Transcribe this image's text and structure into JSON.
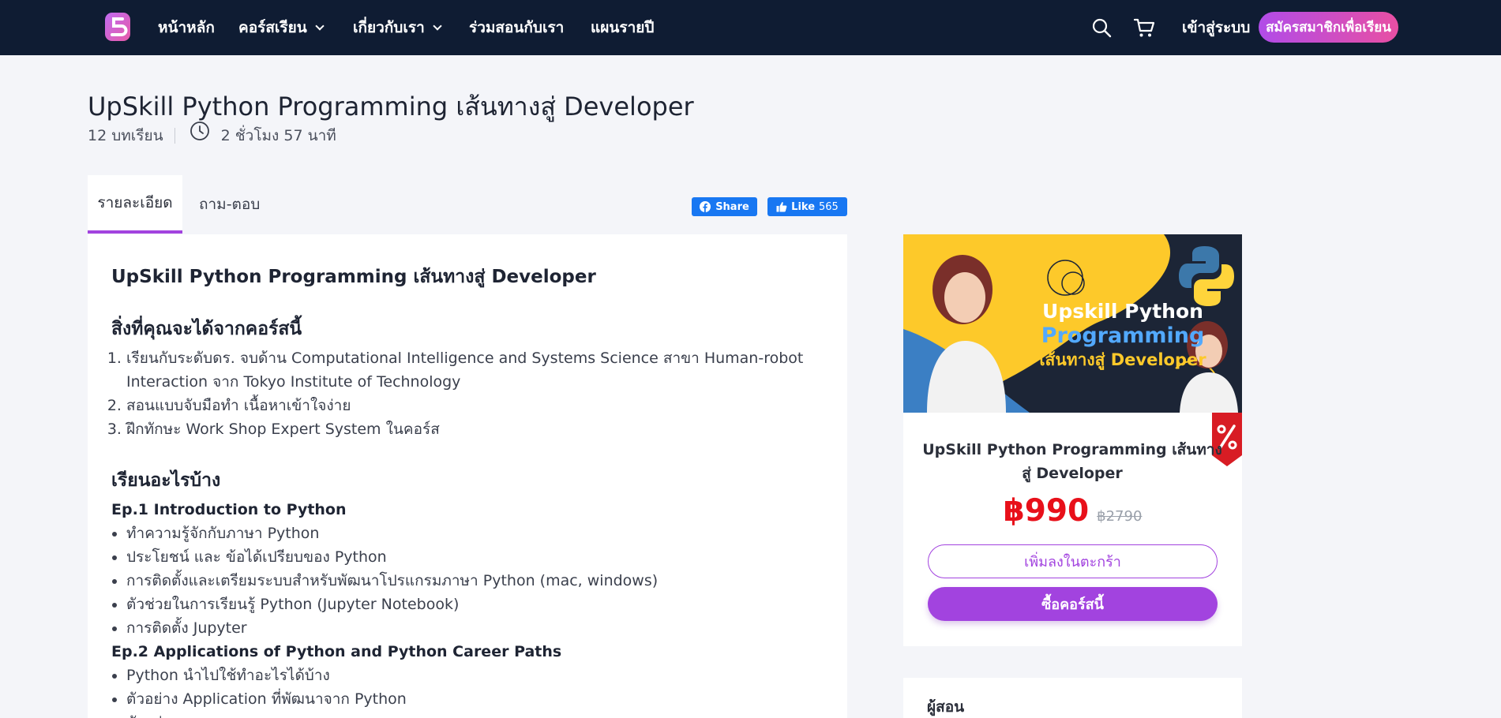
{
  "nav": {
    "home": "หน้าหลัก",
    "courses": "คอร์สเรียน",
    "about": "เกี่ยวกับเรา",
    "teach": "ร่วมสอนกับเรา",
    "plans": "แผนรายปี",
    "login": "เข้าสู่ระบบ",
    "signup": "สมัครสมาชิกเพื่อเรียน"
  },
  "course": {
    "title": "UpSkill Python Programming เส้นทางสู่ Developer",
    "lessons": "12 บทเรียน",
    "duration": "2 ชั่วโมง 57 นาที"
  },
  "tabs": {
    "details": "รายละเอียด",
    "qa": "ถาม-ตอบ"
  },
  "social": {
    "share": "Share",
    "like": "Like",
    "like_count": "565"
  },
  "content": {
    "heading": "UpSkill  Python Programming เส้นทางสู่  Developer",
    "gain_heading": "สิ่งที่คุณจะได้จากคอร์สนี้",
    "gains": [
      "เรียนกับระดับดร. จบด้าน Computational Intelligence and Systems Science สาขา Human-robot Interaction จาก Tokyo Institute of Technology",
      "สอนแบบจับมือทำ เนื้อหาเข้าใจง่าย",
      "ฝึกทักษะ Work Shop Expert System ในคอร์ส"
    ],
    "learn_heading": "เรียนอะไรบ้าง",
    "ep1_title": "Ep.1 Introduction to Python",
    "ep1_items": [
      "ทำความรู้จักกับภาษา Python",
      "ประโยชน์ และ ข้อได้เปรียบของ Python",
      "การติดตั้งและเตรียมระบบสำหรับพัฒนาโปรแกรมภาษา Python (mac, windows)",
      "ตัวช่วยในการเรียนรู้ Python (Jupyter Notebook)",
      "การติดตั้ง Jupyter"
    ],
    "ep2_title": "Ep.2 Applications of Python and Python Career Paths",
    "ep2_items": [
      "Python นำไปใช้ทำอะไรได้บ้าง",
      "ตัวอย่าง Application ที่พัฒนาจาก Python",
      "ตัวอย่าง..."
    ]
  },
  "sidebar": {
    "thumb_line1": "Upskill Python",
    "thumb_line2": "Programming",
    "thumb_line3": "เส้นทางสู่ Developer",
    "title": "UpSkill Python Programming เส้นทางสู่ Developer",
    "price": "฿990",
    "old_price": "฿2790",
    "add_to_cart": "เพิ่มลงในตะกร้า",
    "buy": "ซื้อคอร์สนี้",
    "instructor_label": "ผู้สอน"
  },
  "colors": {
    "navbar": "#0f1c33",
    "accent": "#a243df",
    "price": "#e8101a",
    "facebook": "#1877f2"
  }
}
